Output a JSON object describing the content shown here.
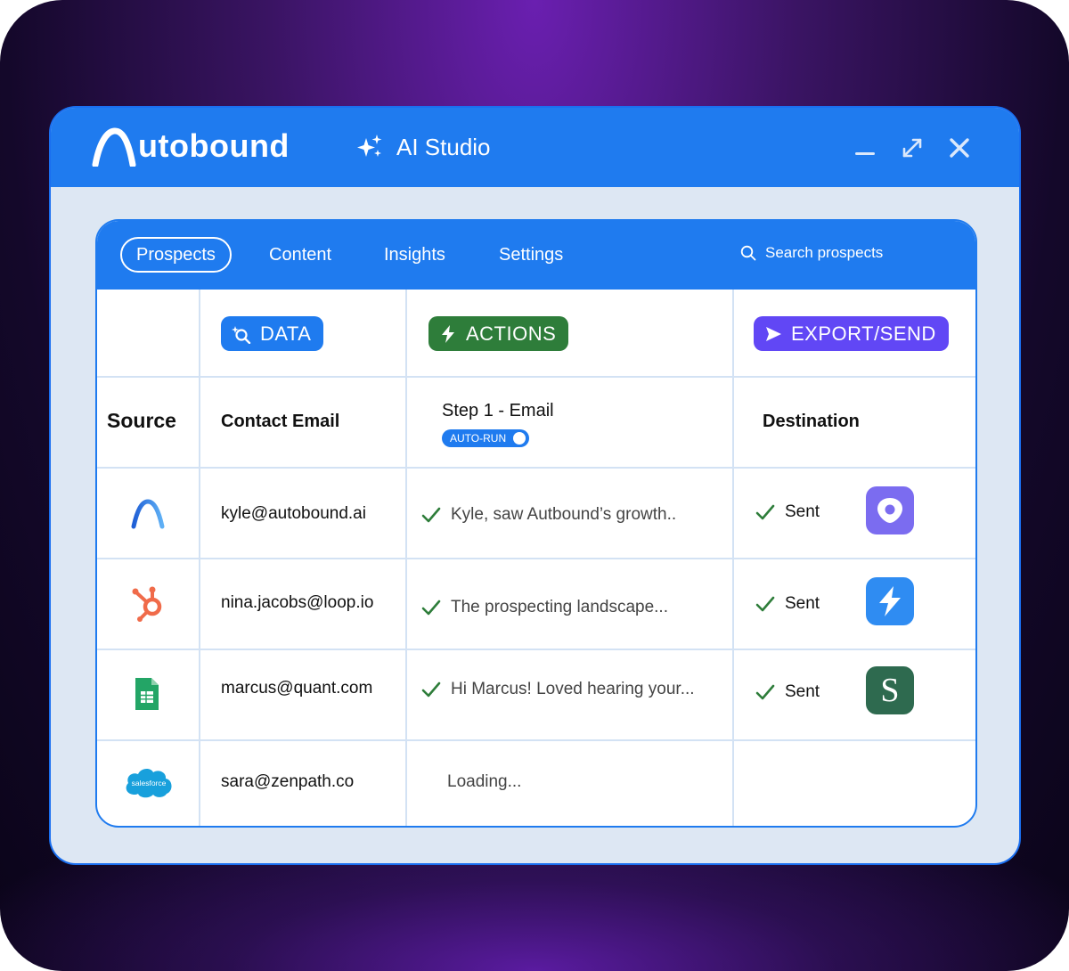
{
  "app": {
    "name": "utobound",
    "section_title": "AI Studio"
  },
  "tabs": [
    {
      "label": "Prospects",
      "active": true
    },
    {
      "label": "Content",
      "active": false
    },
    {
      "label": "Insights",
      "active": false
    },
    {
      "label": "Settings",
      "active": false
    }
  ],
  "search": {
    "placeholder": "Search prospects",
    "icon": "search-icon"
  },
  "window_controls": [
    "minimize-icon",
    "expand-icon",
    "close-icon"
  ],
  "column_pills": {
    "data": {
      "label": "DATA",
      "color": "#1f7bef",
      "icon": "magnify-sparkle-icon"
    },
    "actions": {
      "label": "ACTIONS",
      "color": "#2e7d3a",
      "icon": "bolt-icon"
    },
    "export": {
      "label": "EXPORT/SEND",
      "color": "#6147f5",
      "icon": "send-arrow-icon"
    }
  },
  "headers": {
    "source": "Source",
    "contact_email": "Contact Email",
    "step": "Step 1 - Email",
    "step_badge": "AUTO-RUN",
    "destination": "Destination"
  },
  "rows": [
    {
      "source": "autobound",
      "email": "kyle@autobound.ai",
      "message": "Kyle, saw Autbound’s growth..",
      "status": "Sent",
      "destination": "outreach"
    },
    {
      "source": "hubspot",
      "email": "nina.jacobs@loop.io",
      "message": "The prospecting landscape...",
      "status": "Sent",
      "destination": "apollo"
    },
    {
      "source": "google-sheets",
      "email": "marcus@quant.com",
      "message": "Hi Marcus! Loved hearing your...",
      "status": "Sent",
      "destination": "salesloft"
    },
    {
      "source": "salesforce",
      "email": "sara@zenpath.co",
      "message": "Loading...",
      "status": "",
      "destination": ""
    }
  ],
  "salesforce_label": "salesforce",
  "salesloft_letter": "S",
  "colors": {
    "brand_blue": "#1f7bef",
    "check_green": "#2e7d3a",
    "outreach_purple": "#7b6cf0",
    "apollo_blue": "#2f8cf2",
    "salesloft_green": "#2e6a4f"
  }
}
